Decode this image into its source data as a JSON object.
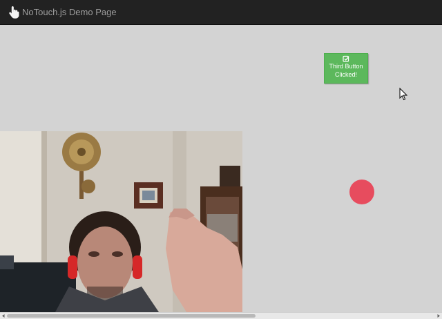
{
  "navbar": {
    "title": "NoTouch.js Demo Page",
    "icon": "hand-pointer-icon"
  },
  "main": {
    "button": {
      "icon": "check-square-icon",
      "label_line1": "Third Button",
      "label_line2": "Clicked!"
    },
    "dot_color": "#e74c5e"
  },
  "colors": {
    "navbar_bg": "#222222",
    "page_bg": "#d3d3d3",
    "success": "#5cb85c"
  }
}
